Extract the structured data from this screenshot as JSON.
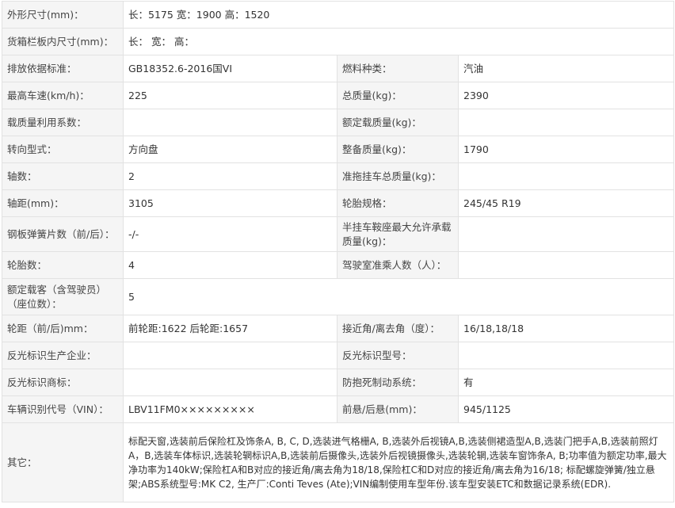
{
  "spec_table": {
    "rows": [
      {
        "cells": [
          {
            "label": "外形尺寸(mm)：",
            "value": "长：5175 宽：1900 高：1520"
          }
        ]
      },
      {
        "cells": [
          {
            "label": "货箱栏板内尺寸(mm)：",
            "value": "长： 宽： 高："
          }
        ]
      },
      {
        "cells": [
          {
            "label": "排放依据标准：",
            "value": "GB18352.6-2016国VI"
          },
          {
            "label": "燃料种类：",
            "value": "汽油"
          }
        ]
      },
      {
        "cells": [
          {
            "label": "最高车速(km/h)：",
            "value": "225"
          },
          {
            "label": "总质量(kg)：",
            "value": "2390"
          }
        ]
      },
      {
        "cells": [
          {
            "label": "载质量利用系数：",
            "value": ""
          },
          {
            "label": "额定载质量(kg)：",
            "value": ""
          }
        ]
      },
      {
        "cells": [
          {
            "label": "转向型式：",
            "value": "方向盘"
          },
          {
            "label": "整备质量(kg)：",
            "value": "1790"
          }
        ]
      },
      {
        "cells": [
          {
            "label": "轴数：",
            "value": "2"
          },
          {
            "label": "准拖挂车总质量(kg)：",
            "value": ""
          }
        ]
      },
      {
        "cells": [
          {
            "label": "轴距(mm)：",
            "value": "3105"
          },
          {
            "label": "轮胎规格：",
            "value": "245/45 R19"
          }
        ]
      },
      {
        "cells": [
          {
            "label": "钢板弹簧片数（前/后）：",
            "value": "-/-"
          },
          {
            "label": "半挂车鞍座最大允许承载质量(kg)：",
            "value": ""
          }
        ]
      },
      {
        "cells": [
          {
            "label": "轮胎数：",
            "value": "4"
          },
          {
            "label": "驾驶室准乘人数（人）：",
            "value": ""
          }
        ]
      },
      {
        "cells": [
          {
            "label": "额定载客（含驾驶员）（座位数）：",
            "value": "5"
          }
        ]
      },
      {
        "cells": [
          {
            "label": "轮距（前/后)mm：",
            "value": "前轮距:1622 后轮距:1657"
          },
          {
            "label": "接近角/离去角（度）：",
            "value": "16/18,18/18"
          }
        ]
      },
      {
        "cells": [
          {
            "label": "反光标识生产企业：",
            "value": ""
          },
          {
            "label": "反光标识型号：",
            "value": ""
          }
        ]
      },
      {
        "cells": [
          {
            "label": "反光标识商标：",
            "value": ""
          },
          {
            "label": "防抱死制动系统：",
            "value": "有"
          }
        ]
      },
      {
        "cells": [
          {
            "label": "车辆识别代号（VIN）：",
            "value": "LBV11FM0×××××××××"
          },
          {
            "label": "前悬/后悬(mm)：",
            "value": "945/1125"
          }
        ]
      },
      {
        "cells": [
          {
            "label": "其它：",
            "value": "标配天窗,选装前后保险杠及饰条A, B, C, D,选装进气格栅A, B,选装外后视镜A,B,选装侧裙造型A,B,选装门把手A,B,选装前照灯A，B,选装车体标识,选装轮辋标识A,B,选装前后摄像头,选装外后视镜摄像头,选装轮辋,选装车窗饰条A, B;功率值为额定功率,最大净功率为140kW;保险杠A和B对应的接近角/离去角为18/18,保险杠C和D对应的接近角/离去角为16/18; 标配螺旋弹簧/独立悬架;ABS系统型号:MK C2, 生产厂:Conti Teves (Ate);VIN编制使用车型年份.该车型安装ETC和数据记录系统(EDR)."
          }
        ]
      }
    ]
  }
}
